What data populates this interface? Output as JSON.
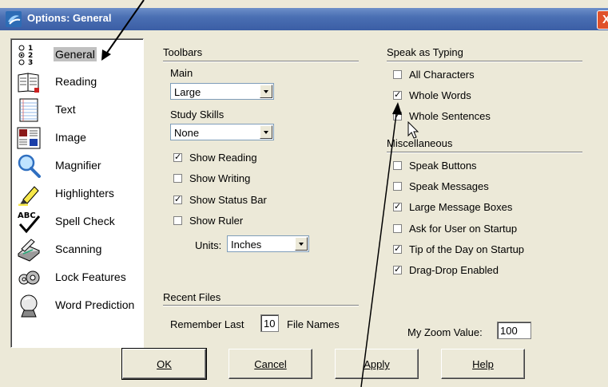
{
  "window": {
    "title": "Options: General",
    "close_glyph": "X"
  },
  "nav": {
    "items": [
      {
        "label": "General",
        "icon": "radio-list-icon",
        "selected": true
      },
      {
        "label": "Reading",
        "icon": "book-icon"
      },
      {
        "label": "Text",
        "icon": "text-page-icon"
      },
      {
        "label": "Image",
        "icon": "image-icon"
      },
      {
        "label": "Magnifier",
        "icon": "magnifier-icon"
      },
      {
        "label": "Highlighters",
        "icon": "highlighter-icon"
      },
      {
        "label": "Spell Check",
        "icon": "spell-check-icon"
      },
      {
        "label": "Scanning",
        "icon": "scanner-icon"
      },
      {
        "label": "Lock Features",
        "icon": "lock-icon"
      },
      {
        "label": "Word Prediction",
        "icon": "crystal-ball-icon"
      }
    ]
  },
  "toolbars": {
    "heading": "Toolbars",
    "main_label": "Main",
    "main_value": "Large",
    "study_label": "Study Skills",
    "study_value": "None",
    "checks": [
      {
        "label": "Show Reading",
        "checked": true
      },
      {
        "label": "Show Writing",
        "checked": false
      },
      {
        "label": "Show Status Bar",
        "checked": true
      },
      {
        "label": "Show Ruler",
        "checked": false
      }
    ],
    "units_label": "Units:",
    "units_value": "Inches"
  },
  "recent": {
    "heading": "Recent Files",
    "prefix": "Remember Last",
    "value": "10",
    "suffix": "File Names"
  },
  "speak": {
    "heading": "Speak as Typing",
    "checks": [
      {
        "label": "All Characters",
        "checked": false
      },
      {
        "label": "Whole Words",
        "checked": true
      },
      {
        "label": "Whole Sentences",
        "checked": true
      }
    ]
  },
  "misc": {
    "heading": "Miscellaneous",
    "checks": [
      {
        "label": "Speak Buttons",
        "checked": false
      },
      {
        "label": "Speak Messages",
        "checked": false
      },
      {
        "label": "Large Message Boxes",
        "checked": true
      },
      {
        "label": "Ask for User on Startup",
        "checked": false
      },
      {
        "label": "Tip of the Day on Startup",
        "checked": true
      },
      {
        "label": "Drag-Drop Enabled",
        "checked": true
      }
    ]
  },
  "zoom": {
    "label": "My Zoom Value:",
    "value": "100"
  },
  "buttons": {
    "ok": "OK",
    "cancel": "Cancel",
    "apply": "Apply",
    "help": "Help"
  },
  "check_glyph": "✓"
}
